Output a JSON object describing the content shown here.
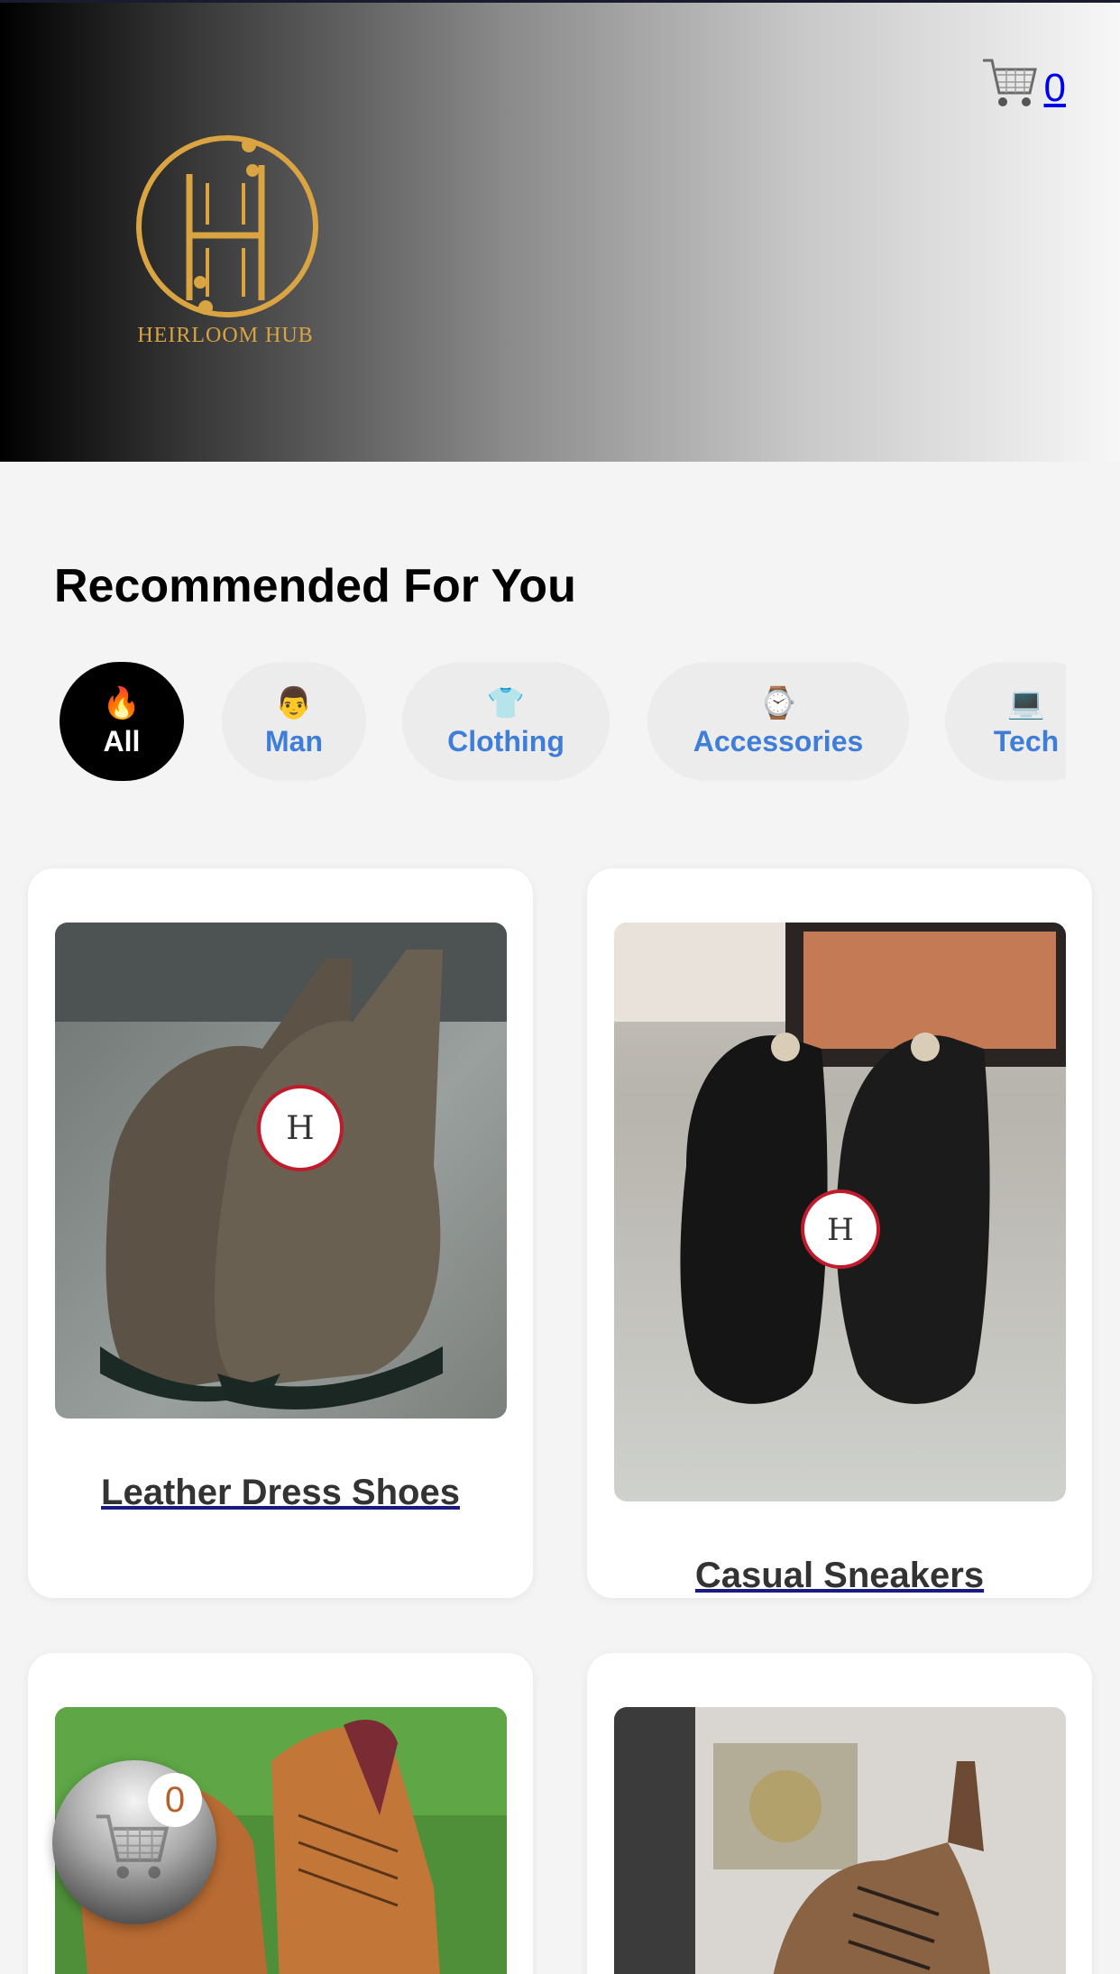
{
  "header": {
    "brand_name": "HEIRLOOM HUB",
    "cart_count": "0"
  },
  "section": {
    "title": "Recommended For You"
  },
  "categories": [
    {
      "emoji": "🔥",
      "label": "All",
      "active": true
    },
    {
      "emoji": "👨",
      "label": "Man",
      "active": false
    },
    {
      "emoji": "👕",
      "label": "Clothing",
      "active": false
    },
    {
      "emoji": "⌚",
      "label": "Accessories",
      "active": false
    },
    {
      "emoji": "💻",
      "label": "Tech",
      "active": false
    }
  ],
  "products": [
    {
      "name": "Leather Dress Shoes",
      "image": "brown-chelsea-boots-photo"
    },
    {
      "name": "Casual Sneakers",
      "image": "black-oxford-shoes-photo"
    },
    {
      "name": "",
      "image": "tan-brogue-boots-photo"
    },
    {
      "name": "",
      "image": "suede-boots-photo"
    }
  ],
  "floating_cart": {
    "count": "0"
  },
  "colors": {
    "brand_gold": "#d9a441",
    "category_text": "#3f7ed8",
    "active_category_bg": "#000000"
  }
}
